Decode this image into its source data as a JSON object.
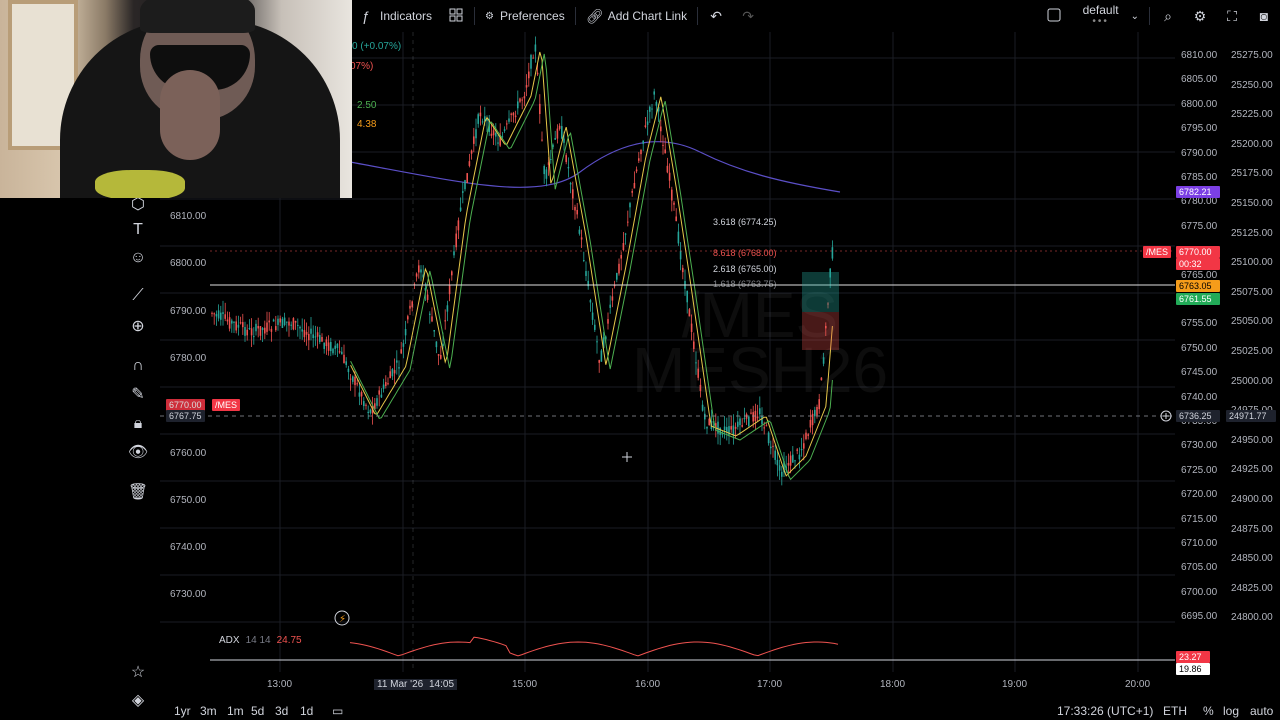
{
  "toolbar": {
    "indicators_label": "Indicators",
    "preferences_label": "Preferences",
    "add_chart_link_label": "Add Chart Link",
    "layout_name": "default"
  },
  "chart": {
    "symbol_watermark_line1": "/MES",
    "symbol_watermark_line2": "MESH26",
    "legend": {
      "change": "0 (+0.07%)",
      "pct": "07%)",
      "ma1": "2.50",
      "ma2": "4.38"
    },
    "fib_labels": {
      "f1": "3.618 (6774.25)",
      "f2": "8.618 (6768.00)",
      "f3": "2.618 (6765.00)",
      "f4": "1.618 (6763.75)"
    },
    "price_axis_main": [
      "6810.00",
      "6805.00",
      "6800.00",
      "6795.00",
      "6790.00",
      "6785.00",
      "6780.00",
      "6775.00",
      "6770.00",
      "6765.00",
      "6760.00",
      "6755.00",
      "6750.00",
      "6745.00",
      "6740.00",
      "6735.00",
      "6730.00",
      "6725.00",
      "6720.00",
      "6715.00",
      "6710.00",
      "6705.00",
      "6700.00",
      "6695.00"
    ],
    "price_axis_secondary": [
      "25275.00",
      "25250.00",
      "25225.00",
      "25200.00",
      "25175.00",
      "25150.00",
      "25125.00",
      "25100.00",
      "25075.00",
      "25050.00",
      "25025.00",
      "25000.00",
      "24975.00",
      "24950.00",
      "24925.00",
      "24900.00",
      "24875.00",
      "24850.00",
      "24825.00",
      "24800.00"
    ],
    "left_axis": [
      "6810.00",
      "6800.00",
      "6790.00",
      "6780.00",
      "6760.00",
      "6750.00",
      "6740.00",
      "6730.00"
    ],
    "tags": {
      "purple_price": "6782.21",
      "symbol_tag": "/MES",
      "last_price": "6770.00",
      "countdown": "00:32",
      "orange_price": "6763.05",
      "green_price": "6761.55",
      "crosshair_price": "6736.25",
      "crosshair_price2": "24971.77",
      "left_red_price": "6770.00",
      "left_symbol": "/MES",
      "left_crosshair": "6767.75",
      "adx_value_red": "23.27",
      "adx_value_white": "19.86"
    },
    "adx": {
      "name": "ADX",
      "params": "14 14",
      "value": "24.75"
    },
    "time_axis": [
      "13:00",
      "11 Mar '26",
      "14:05",
      "15:00",
      "16:00",
      "17:00",
      "18:00",
      "19:00",
      "20:00"
    ]
  },
  "bottom": {
    "ranges": [
      "1yr",
      "3m",
      "1m",
      "5d",
      "3d",
      "1d"
    ],
    "clock": "17:33:26 (UTC+1)",
    "session": "ETH",
    "pct": "%",
    "log": "log",
    "auto": "auto"
  },
  "colors": {
    "up": "#26a69a",
    "down": "#ef5350",
    "background": "#000000",
    "ma_yellow": "#e6c84a",
    "ma_green": "#4caf50",
    "ma_purple": "#5b4fc7",
    "tag_red": "#f23645",
    "tag_orange": "#f59c1a",
    "tag_green": "#22ab58",
    "tag_purple": "#7b3fe4"
  }
}
